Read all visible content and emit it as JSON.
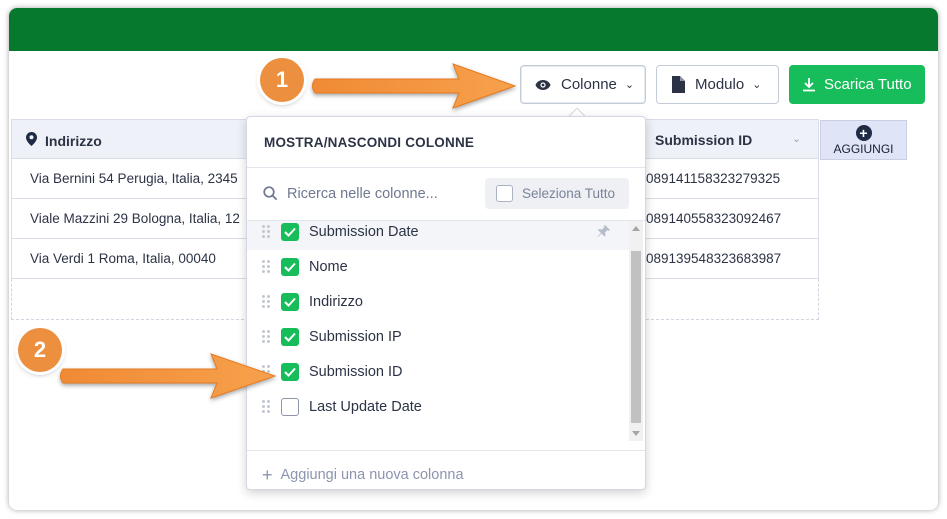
{
  "colors": {
    "topbar": "#06792f",
    "primary_button": "#18bd5b",
    "checkbox_checked": "#18bd5b",
    "callout": "#ec8f3e"
  },
  "toolbar": {
    "columns_label": "Colonne",
    "columns_icon": "eye-icon",
    "form_label": "Modulo",
    "form_icon": "document-icon",
    "download_label": "Scarica Tutto",
    "download_icon": "download-icon"
  },
  "table": {
    "headers": {
      "address": "Indirizzo",
      "submission_id": "Submission ID",
      "add": "AGGIUNGI"
    },
    "rows": [
      {
        "address": "Via Bernini 54 Perugia, Italia, 2345",
        "submission_id": "089141158323279325"
      },
      {
        "address": "Viale Mazzini 29 Bologna, Italia, 12",
        "submission_id": "089140558323092467"
      },
      {
        "address": "Via Verdi 1 Roma, Italia, 00040",
        "submission_id": "089139548323683987"
      }
    ]
  },
  "columns_panel": {
    "title": "MOSTRA/NASCONDI COLONNE",
    "search_placeholder": "Ricerca nelle colonne...",
    "select_all": "Seleziona Tutto",
    "items": [
      {
        "label": "Submission Date",
        "checked": true,
        "pinned": true
      },
      {
        "label": "Nome",
        "checked": true
      },
      {
        "label": "Indirizzo",
        "checked": true
      },
      {
        "label": "Submission IP",
        "checked": true
      },
      {
        "label": "Submission ID",
        "checked": true
      },
      {
        "label": "Last Update Date",
        "checked": false
      }
    ],
    "add_column": "Aggiungi una nuova colonna"
  },
  "callouts": [
    "1",
    "2"
  ]
}
